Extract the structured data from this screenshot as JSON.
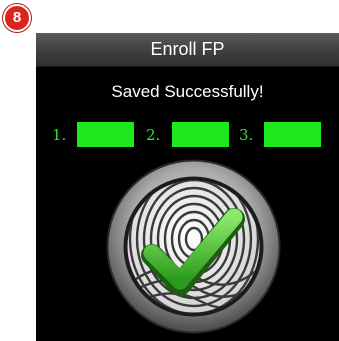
{
  "step_badge": "8",
  "screen": {
    "title": "Enroll FP",
    "status_message": "Saved Successfully!",
    "slots": [
      {
        "label": "1.",
        "state": "captured"
      },
      {
        "label": "2.",
        "state": "captured"
      },
      {
        "label": "3.",
        "state": "captured"
      }
    ],
    "indicator": {
      "icon": "fingerprint-checkmark-icon",
      "result": "success"
    }
  },
  "colors": {
    "background": "#000000",
    "slot_fill": "#1ee81e",
    "slot_label": "#2fe52f",
    "badge": "#d9251c",
    "check": "#3fbf2a"
  }
}
